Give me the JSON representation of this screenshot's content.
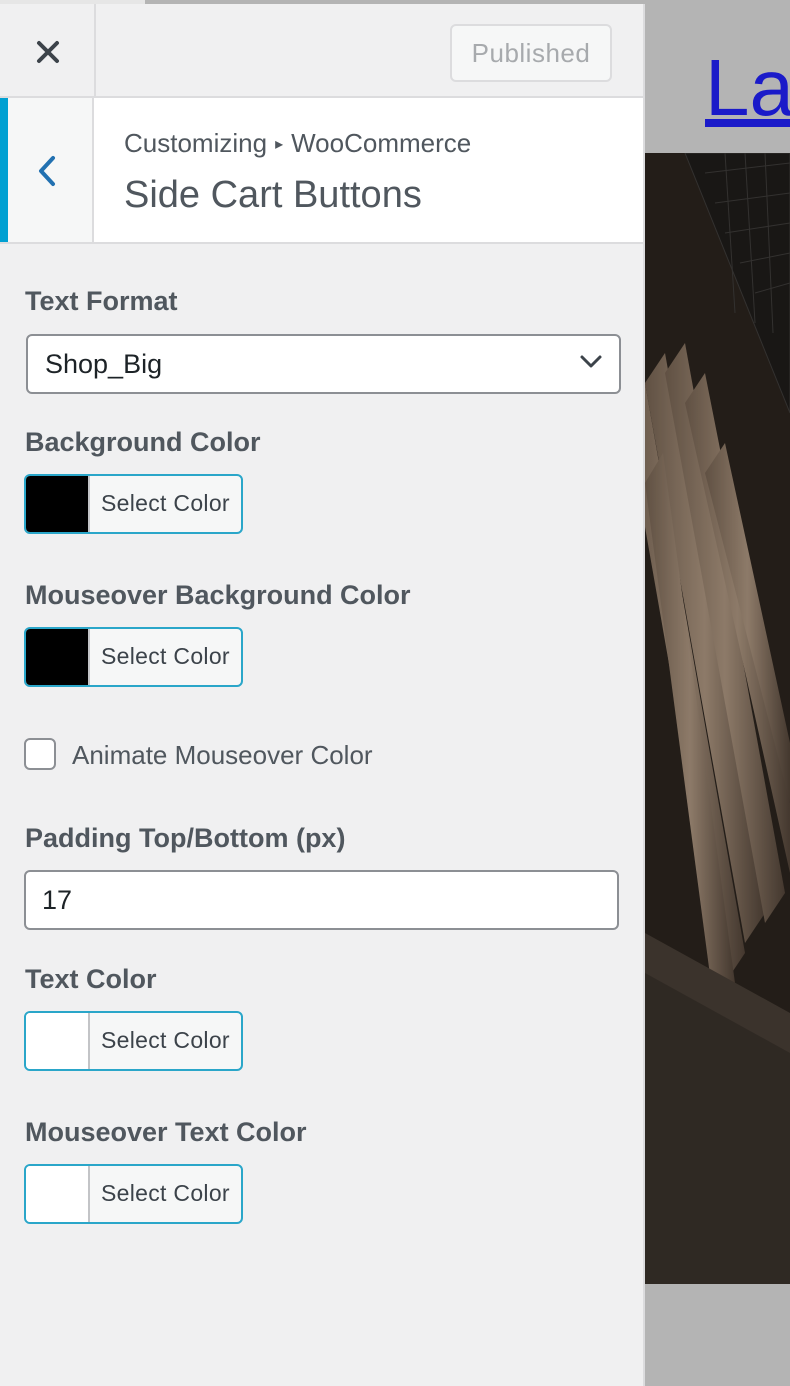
{
  "topbar": {
    "close_label": "Close",
    "publish_label": "Published"
  },
  "header": {
    "back_label": "Back",
    "breadcrumb_root": "Customizing",
    "breadcrumb_separator": "▸",
    "breadcrumb_parent": "WooCommerce",
    "title": "Side Cart Buttons"
  },
  "controls": {
    "text_format": {
      "label": "Text Format",
      "value": "Shop_Big"
    },
    "background_color": {
      "label": "Background Color",
      "button": "Select Color",
      "color": "#000000"
    },
    "mouseover_background_color": {
      "label": "Mouseover Background Color",
      "button": "Select Color",
      "color": "#000000"
    },
    "animate_mouseover": {
      "label": "Animate Mouseover Color",
      "checked": false
    },
    "padding": {
      "label": "Padding Top/Bottom (px)",
      "value": "17"
    },
    "text_color": {
      "label": "Text Color",
      "button": "Select Color",
      "color": "#ffffff"
    },
    "mouseover_text_color": {
      "label": "Mouseover Text Color",
      "button": "Select Color",
      "color": "#ffffff"
    }
  },
  "preview": {
    "site_title": "La"
  },
  "colors": {
    "accent": "#00a0d2",
    "link": "#1a1ac9",
    "panel_bg": "#f0f0f1"
  },
  "icons": {
    "close": "close-icon",
    "back": "chevron-left-icon",
    "select": "chevron-down-icon"
  }
}
